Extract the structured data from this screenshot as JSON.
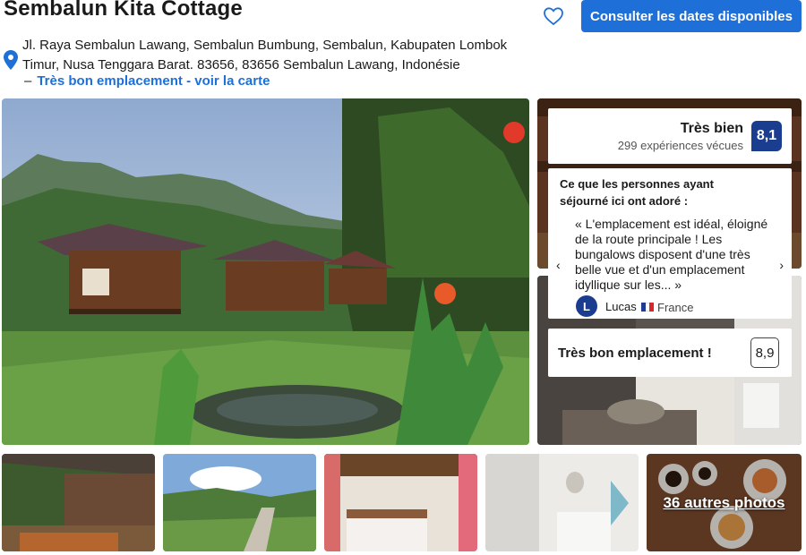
{
  "header": {
    "title": "Sembalun Kita Cottage",
    "cta_label": "Consulter les dates disponibles",
    "address_line1": "Jl. Raya Sembalun Lawang, Sembalun Bumbung, Sembalun, Kabupaten Lombok",
    "address_line2": "Timur, Nusa Tenggara Barat. 83656, 83656 Sembalun Lawang, Indonésie",
    "map_dash": "–",
    "map_link": "Très bon emplacement - voir la carte"
  },
  "score": {
    "word": "Très bien",
    "count": "299 expériences vécues",
    "value": "8,1"
  },
  "review": {
    "heading": "Ce que les personnes ayant séjourné ici ont adoré :",
    "quote": "« L'emplacement est idéal, éloigné de la route principale ! Les bungalows disposent d'une très belle vue et d'un emplacement idyllique sur les... »",
    "avatar_letter": "L",
    "reviewer": "Lucas",
    "country": "France",
    "prev_arrow": "‹",
    "next_arrow": "›"
  },
  "location": {
    "label": "Très bon emplacement !",
    "score": "8,9"
  },
  "gallery": {
    "more_photos": "36 autres photos"
  },
  "colors": {
    "brand_blue": "#1f6fd8",
    "score_navy": "#1a3d8f"
  },
  "icons": [
    "heart-icon",
    "map-pin-icon",
    "chevron-left-icon",
    "chevron-right-icon",
    "france-flag-icon"
  ]
}
